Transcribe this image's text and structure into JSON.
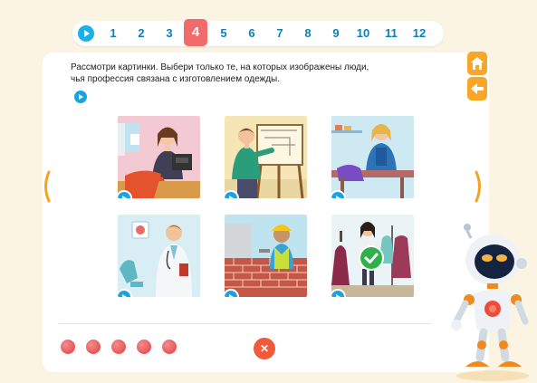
{
  "nav": {
    "pages": [
      "1",
      "2",
      "3",
      "4",
      "5",
      "6",
      "7",
      "8",
      "9",
      "10",
      "11",
      "12"
    ],
    "current_page": "4"
  },
  "task": {
    "instruction_line1": "Рассмотри картинки. Выбери только те, на которых изображены люди,",
    "instruction_line2": "чья профессия связана с изготовлением одежды."
  },
  "tiles": [
    {
      "id": "seamstress-sewing-machine",
      "selected": false
    },
    {
      "id": "architect-drawing-board",
      "selected": false
    },
    {
      "id": "tailor-cutting-fabric",
      "selected": false
    },
    {
      "id": "doctor",
      "selected": false
    },
    {
      "id": "bricklayer",
      "selected": false
    },
    {
      "id": "fashion-designer",
      "selected": true
    }
  ],
  "attempts": {
    "remaining": 5
  },
  "controls": {
    "reset_symbol": "✕",
    "home_icon": "home-icon",
    "back_icon": "back-arrow-icon"
  },
  "colors": {
    "accent_orange": "#f7a628",
    "page_active": "#f26b6b",
    "page_number": "#0f7fb6",
    "audio_blue": "#1aa3e0",
    "attempt_red": "#df3f44",
    "selected_green": "#2eb14a"
  }
}
